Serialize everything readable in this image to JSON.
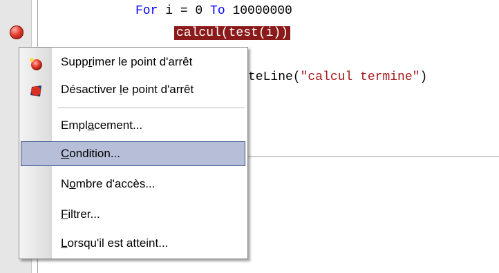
{
  "editor": {
    "line1": {
      "kw1": "For",
      "mid1": " i = 0 ",
      "kw2": "To",
      "rest": " 10000000"
    },
    "line2": {
      "highlighted": "calcul(test(i))"
    },
    "line3": {
      "prefix": "teLine(",
      "string": "\"calcul termine\"",
      "suffix": ")"
    }
  },
  "context_menu": {
    "items": [
      {
        "pre": "Supp",
        "u": "r",
        "post": "imer le point d'arrêt",
        "icon": "breakpoint-delete-icon"
      },
      {
        "pre": "Désactiver ",
        "u": "l",
        "post": "e point d'arrêt",
        "icon": "breakpoint-disable-icon"
      },
      {
        "pre": "Empl",
        "u": "a",
        "post": "cement..."
      },
      {
        "pre": "",
        "u": "C",
        "post": "ondition...",
        "selected": true
      },
      {
        "pre": "N",
        "u": "o",
        "post": "mbre d'accès..."
      },
      {
        "pre": "",
        "u": "F",
        "post": "iltrer..."
      },
      {
        "pre": "",
        "u": "L",
        "post": "orsqu'il est atteint..."
      }
    ]
  },
  "colors": {
    "keyword": "#0000ff",
    "string": "#a31515",
    "highlight_bg": "#8b1a1a",
    "selection_bg": "#b6bed8",
    "selection_border": "#3a4a86"
  }
}
